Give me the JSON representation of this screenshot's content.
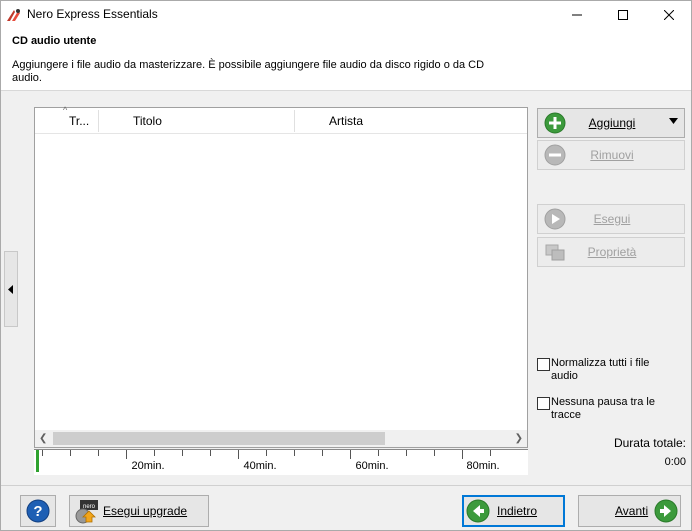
{
  "window": {
    "title": "Nero Express Essentials",
    "controls": {
      "minimize": "minimize-icon",
      "maximize": "maximize-icon",
      "close": "close-icon"
    }
  },
  "header": {
    "title": "CD audio utente",
    "description": "Aggiungere i file audio da masterizzare. È possibile aggiungere file audio da disco rigido o da CD audio."
  },
  "list": {
    "columns": [
      "Tr...",
      "Titolo",
      "Artista"
    ],
    "rows": []
  },
  "ruler": {
    "labels": [
      "20min.",
      "40min.",
      "60min.",
      "80min."
    ]
  },
  "actions": {
    "add": "Aggiungi",
    "remove": "Rimuovi",
    "play": "Esegui",
    "properties": "Proprietà"
  },
  "options": {
    "normalize": {
      "label": "Normalizza tutti i file audio",
      "checked": false
    },
    "no_pause": {
      "label": "Nessuna pausa tra le tracce",
      "checked": false
    }
  },
  "duration": {
    "label": "Durata totale:",
    "value": "0:00"
  },
  "footer": {
    "upgrade": "Esegui upgrade",
    "back": "Indietro",
    "next": "Avanti"
  },
  "colors": {
    "accent": "#0078d7",
    "green": "#3c9a3c",
    "disabled_text": "#a0a0a0"
  }
}
